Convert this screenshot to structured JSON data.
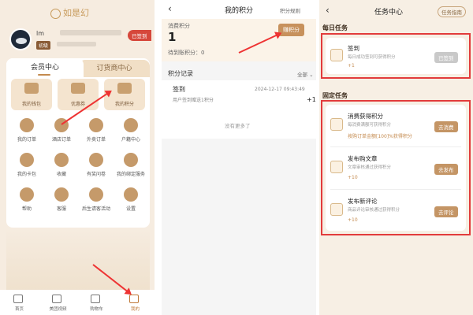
{
  "p1": {
    "logo": "如是幻",
    "user_name": "lm",
    "level_badge": "初级",
    "sign_btn": "已签到",
    "tabs": [
      "会员中心",
      "订货商中心"
    ],
    "big_items": [
      "我的钱包",
      "优惠券",
      "我的积分"
    ],
    "grid_items": [
      "我的订单",
      "酒店订单",
      "外卖订单",
      "户籍中心",
      "我的卡包",
      "收藏",
      "有奖问卷",
      "我的绑定服务",
      "帮助",
      "客服",
      "后生请客活动",
      "设置"
    ],
    "nav": [
      "首页",
      "美团视频",
      "购物车",
      "我的"
    ]
  },
  "p2": {
    "title": "我的积分",
    "rule": "积分规则",
    "points_label": "消费积分",
    "points_value": "1",
    "earn_btn": "赚积分",
    "pending": "待到账积分：0",
    "record_title": "积分记录",
    "filter": "全部",
    "record": {
      "name": "签到",
      "date": "2024-12-17 09:43:49",
      "desc": "用户签到赠送1积分",
      "value": "+1"
    },
    "no_more": "没有更多了"
  },
  "p3": {
    "title": "任务中心",
    "guide": "任务指南",
    "daily_title": "每日任务",
    "fixed_title": "固定任务",
    "daily": {
      "name": "签到",
      "desc": "每日成功签到可获得积分",
      "points": "+1",
      "btn": "已签到"
    },
    "fixed": [
      {
        "name": "消费获得积分",
        "desc": "每消费满额可获得积分",
        "points": "按购订单金额[100]%获得积分",
        "btn": "去消费"
      },
      {
        "name": "发布购文章",
        "desc": "文章审核通过获得积分",
        "points": "+10",
        "btn": "去发布"
      },
      {
        "name": "发布新评论",
        "desc": "商品评论审核通过获得积分",
        "points": "+10",
        "btn": "去评论"
      }
    ]
  },
  "colors": {
    "accent": "#c49565",
    "highlight": "#e23b3b",
    "brand": "#c79a5a"
  }
}
